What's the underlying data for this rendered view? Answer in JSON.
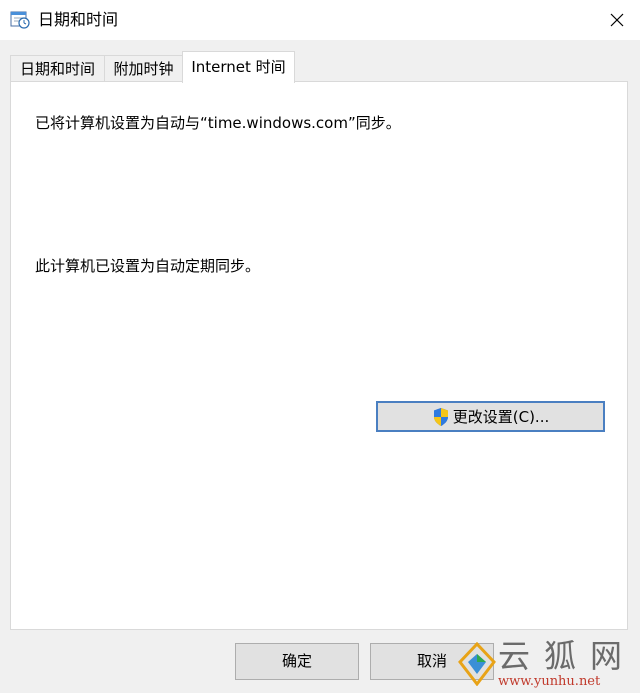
{
  "window": {
    "title": "日期和时间",
    "icon": "date-time-icon",
    "close_icon": "close-icon"
  },
  "tabs": [
    {
      "label": "日期和时间",
      "active": false
    },
    {
      "label": "附加时钟",
      "active": false
    },
    {
      "label": "Internet 时间",
      "active": true
    }
  ],
  "panel": {
    "sync_server_text": "已将计算机设置为自动与“time.windows.com”同步。",
    "auto_sync_text": "此计算机已设置为自动定期同步。",
    "change_button_label": "更改设置(C)...",
    "change_button_icon": "uac-shield-icon"
  },
  "footer": {
    "ok_label": "确定",
    "cancel_label": "取消"
  },
  "watermark": {
    "text": "云狐网",
    "url": "www.yunhu.net"
  },
  "colors": {
    "accent_border": "#4a7fc1",
    "window_bg": "#f0f0f0",
    "panel_bg": "#ffffff"
  }
}
